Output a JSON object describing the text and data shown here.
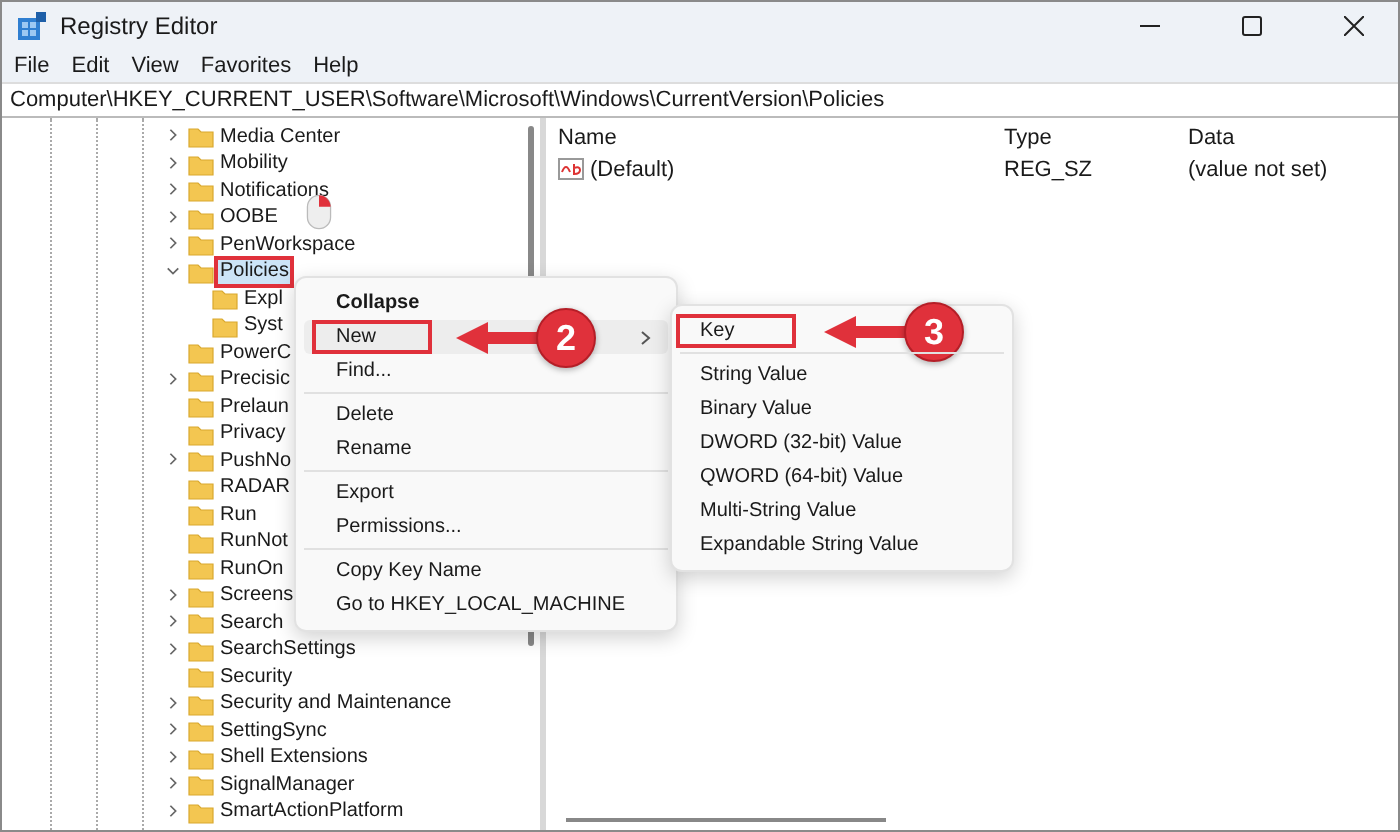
{
  "window": {
    "title": "Registry Editor"
  },
  "menu_bar": [
    "File",
    "Edit",
    "View",
    "Favorites",
    "Help"
  ],
  "address_bar": "Computer\\HKEY_CURRENT_USER\\Software\\Microsoft\\Windows\\CurrentVersion\\Policies",
  "tree": [
    {
      "label": "Media Center",
      "expandable": true,
      "expanded": false,
      "selected": false
    },
    {
      "label": "Mobility",
      "expandable": true,
      "expanded": false,
      "selected": false
    },
    {
      "label": "Notifications",
      "expandable": true,
      "expanded": false,
      "selected": false
    },
    {
      "label": "OOBE",
      "expandable": true,
      "expanded": false,
      "selected": false
    },
    {
      "label": "PenWorkspace",
      "expandable": true,
      "expanded": false,
      "selected": false
    },
    {
      "label": "Policies",
      "expandable": true,
      "expanded": true,
      "selected": true,
      "children": [
        {
          "label": "Expl",
          "expandable": false,
          "expanded": false,
          "selected": false
        },
        {
          "label": "Syst",
          "expandable": false,
          "expanded": false,
          "selected": false
        }
      ]
    },
    {
      "label": "PowerC",
      "expandable": false,
      "expanded": false,
      "selected": false
    },
    {
      "label": "Precisic",
      "expandable": true,
      "expanded": false,
      "selected": false
    },
    {
      "label": "Prelaun",
      "expandable": false,
      "expanded": false,
      "selected": false
    },
    {
      "label": "Privacy",
      "expandable": false,
      "expanded": false,
      "selected": false
    },
    {
      "label": "PushNo",
      "expandable": true,
      "expanded": false,
      "selected": false
    },
    {
      "label": "RADAR",
      "expandable": false,
      "expanded": false,
      "selected": false
    },
    {
      "label": "Run",
      "expandable": false,
      "expanded": false,
      "selected": false
    },
    {
      "label": "RunNot",
      "expandable": false,
      "expanded": false,
      "selected": false
    },
    {
      "label": "RunOn",
      "expandable": false,
      "expanded": false,
      "selected": false
    },
    {
      "label": "Screens",
      "expandable": true,
      "expanded": false,
      "selected": false
    },
    {
      "label": "Search",
      "expandable": true,
      "expanded": false,
      "selected": false
    },
    {
      "label": "SearchSettings",
      "expandable": true,
      "expanded": false,
      "selected": false
    },
    {
      "label": "Security",
      "expandable": false,
      "expanded": false,
      "selected": false
    },
    {
      "label": "Security and Maintenance",
      "expandable": true,
      "expanded": false,
      "selected": false
    },
    {
      "label": "SettingSync",
      "expandable": true,
      "expanded": false,
      "selected": false
    },
    {
      "label": "Shell Extensions",
      "expandable": true,
      "expanded": false,
      "selected": false
    },
    {
      "label": "SignalManager",
      "expandable": true,
      "expanded": false,
      "selected": false
    },
    {
      "label": "SmartActionPlatform",
      "expandable": true,
      "expanded": false,
      "selected": false
    }
  ],
  "values": {
    "columns": [
      "Name",
      "Type",
      "Data"
    ],
    "rows": [
      {
        "name": "(Default)",
        "type": "REG_SZ",
        "data": "(value not set)"
      }
    ]
  },
  "context_menu": [
    {
      "label": "Collapse",
      "default": true,
      "highlighted": false,
      "submenu": false,
      "outlined": false,
      "separator_before": false
    },
    {
      "label": "New",
      "default": false,
      "highlighted": true,
      "submenu": true,
      "outlined": true,
      "separator_before": false,
      "callout": "2"
    },
    {
      "label": "Find...",
      "default": false,
      "highlighted": false,
      "submenu": false,
      "outlined": false,
      "separator_before": false
    },
    {
      "label": "Delete",
      "default": false,
      "highlighted": false,
      "submenu": false,
      "outlined": false,
      "separator_before": true
    },
    {
      "label": "Rename",
      "default": false,
      "highlighted": false,
      "submenu": false,
      "outlined": false,
      "separator_before": false
    },
    {
      "label": "Export",
      "default": false,
      "highlighted": false,
      "submenu": false,
      "outlined": false,
      "separator_before": true
    },
    {
      "label": "Permissions...",
      "default": false,
      "highlighted": false,
      "submenu": false,
      "outlined": false,
      "separator_before": false
    },
    {
      "label": "Copy Key Name",
      "default": false,
      "highlighted": false,
      "submenu": false,
      "outlined": false,
      "separator_before": true
    },
    {
      "label": "Go to HKEY_LOCAL_MACHINE",
      "default": false,
      "highlighted": false,
      "submenu": false,
      "outlined": false,
      "separator_before": false
    }
  ],
  "submenu": [
    {
      "label": "Key",
      "outlined": true,
      "separator_before": false,
      "callout": "3"
    },
    {
      "label": "String Value",
      "outlined": false,
      "separator_before": true
    },
    {
      "label": "Binary Value",
      "outlined": false,
      "separator_before": false
    },
    {
      "label": "DWORD (32-bit) Value",
      "outlined": false,
      "separator_before": false
    },
    {
      "label": "QWORD (64-bit) Value",
      "outlined": false,
      "separator_before": false
    },
    {
      "label": "Multi-String Value",
      "outlined": false,
      "separator_before": false
    },
    {
      "label": "Expandable String Value",
      "outlined": false,
      "separator_before": false
    }
  ]
}
